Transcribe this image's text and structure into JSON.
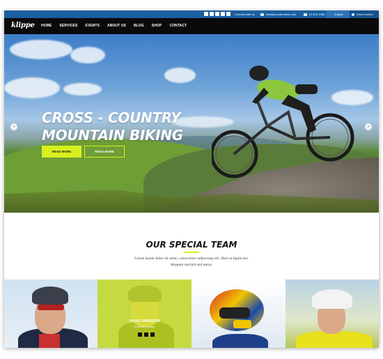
{
  "topbar": {
    "connect": "Connect with us",
    "email": "info@yoursitename.com",
    "phone": "01 876 4286",
    "language": "English",
    "howto": "How it works!"
  },
  "nav": {
    "logo": "klippe",
    "items": [
      "HOME",
      "SERVICES",
      "EVENTS",
      "ABOUT US",
      "BLOG",
      "SHOP",
      "CONTACT"
    ]
  },
  "hero": {
    "title_line1": "CROSS - COUNTRY",
    "title_line2": "MOUNTAIN BIKING",
    "btn_primary": "READ MORE",
    "btn_secondary": "READ MORE",
    "arrow_left": "‹",
    "arrow_right": "›"
  },
  "team": {
    "title": "OUR SPECIAL TEAM",
    "desc_line1": "Lorem ipsum dolor sit amet, consectetur adipiscing elit. Duis ut ligula leo.",
    "desc_line2": "Aliquam suscipit sed purus.",
    "featured_name": "DAVID HARRISON",
    "featured_role": "Personal Trainer"
  },
  "colors": {
    "accent": "#d9f01e",
    "topbar": "#1a5fa0",
    "nav": "#0a0a0a"
  },
  "icons": [
    "facebook-icon",
    "twitter-icon",
    "google-plus-icon",
    "linkedin-icon",
    "youtube-icon",
    "email-icon",
    "phone-icon",
    "info-icon",
    "chevron-left-icon",
    "chevron-right-icon"
  ]
}
